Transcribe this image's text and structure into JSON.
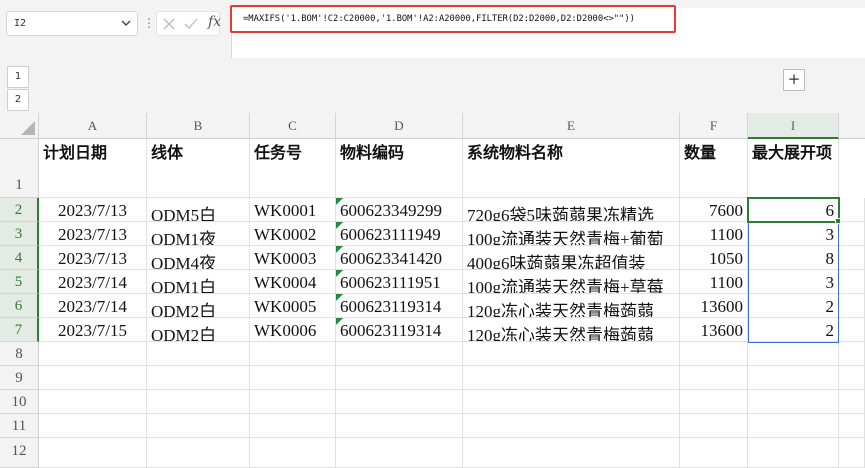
{
  "name_box": {
    "value": "I2"
  },
  "formula_bar": {
    "formula": "=MAXIFS('1.BOM'!C2:C20000,'1.BOM'!A2:A20000,FILTER(D2:D2000,D2:D2000<>\"\"))",
    "fx_label": "fx"
  },
  "outline": {
    "levels": [
      "1",
      "2"
    ],
    "expand_label": "+"
  },
  "columns": [
    "A",
    "B",
    "C",
    "D",
    "E",
    "F",
    "I"
  ],
  "row_numbers": [
    "1",
    "2",
    "3",
    "4",
    "5",
    "6",
    "7",
    "8",
    "9",
    "10",
    "11",
    "12"
  ],
  "header_row": {
    "a": "计划日期",
    "b": "线体",
    "c": "任务号",
    "d": "物料编码",
    "e": "系统物料名称",
    "f": "数量",
    "i": "最大展开项"
  },
  "rows": [
    {
      "a": "2023/7/13",
      "b": "ODM5白",
      "c": "WK0001",
      "d": "600623349299",
      "e": "720g6袋5味蒟蒻果冻精选",
      "f": "7600",
      "i": "6"
    },
    {
      "a": "2023/7/13",
      "b": "ODM1夜",
      "c": "WK0002",
      "d": "600623111949",
      "e": "100g流通装天然青梅+葡萄",
      "f": "1100",
      "i": "3"
    },
    {
      "a": "2023/7/13",
      "b": "ODM4夜",
      "c": "WK0003",
      "d": "600623341420",
      "e": "400g6味蒟蒻果冻超值装",
      "f": "1050",
      "i": "8"
    },
    {
      "a": "2023/7/14",
      "b": "ODM1白",
      "c": "WK0004",
      "d": "600623111951",
      "e": "100g流通装天然青梅+草莓",
      "f": "1100",
      "i": "3"
    },
    {
      "a": "2023/7/14",
      "b": "ODM2白",
      "c": "WK0005",
      "d": "600623119314",
      "e": "120g冻心装天然青梅蒟蒻",
      "f": "13600",
      "i": "2"
    },
    {
      "a": "2023/7/15",
      "b": "ODM2白",
      "c": "WK0006",
      "d": "600623119314",
      "e": "120g冻心装天然青梅蒟蒻",
      "f": "13600",
      "i": "2"
    }
  ],
  "selection": {
    "active_cell": "I2",
    "range": "I2:I7"
  },
  "colors": {
    "accent": "#2e7d32",
    "highlight_border": "#e53935",
    "selection_border": "#3a6fd6"
  }
}
